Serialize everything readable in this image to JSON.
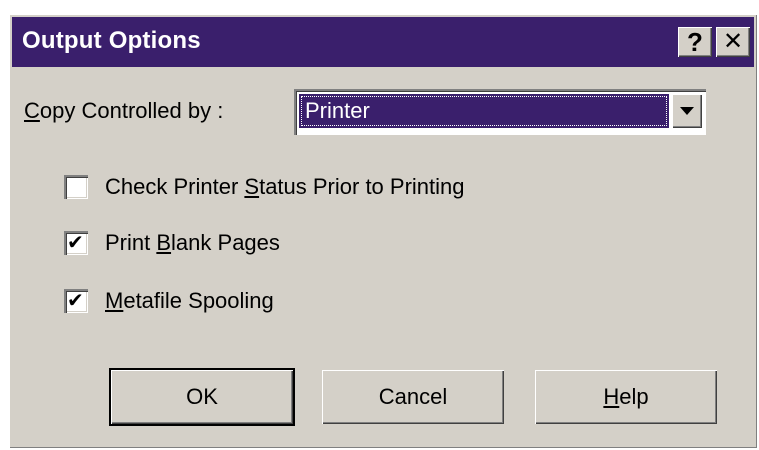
{
  "window": {
    "title": "Output Options",
    "help_glyph": "?",
    "close_glyph": "✕"
  },
  "copy_control": {
    "label_mnemonic": "C",
    "label_rest": "opy Controlled by :",
    "selected_value": "Printer",
    "icon": "chevron-down-icon"
  },
  "checkboxes": [
    {
      "pre": "Check Printer ",
      "mnemonic": "S",
      "post": "tatus Prior to Printing",
      "checked": false
    },
    {
      "pre": "Print ",
      "mnemonic": "B",
      "post": "lank Pages",
      "checked": true
    },
    {
      "pre": "",
      "mnemonic": "M",
      "post": "etafile Spooling",
      "checked": true
    }
  ],
  "check_glyph": "✔",
  "buttons": {
    "ok": "OK",
    "cancel": "Cancel",
    "help_mnemonic": "H",
    "help_rest": "elp"
  },
  "colors": {
    "titlebar": "#3a1f6c",
    "dialog_bg": "#d4d0c8",
    "selection": "#3a1f6c"
  }
}
